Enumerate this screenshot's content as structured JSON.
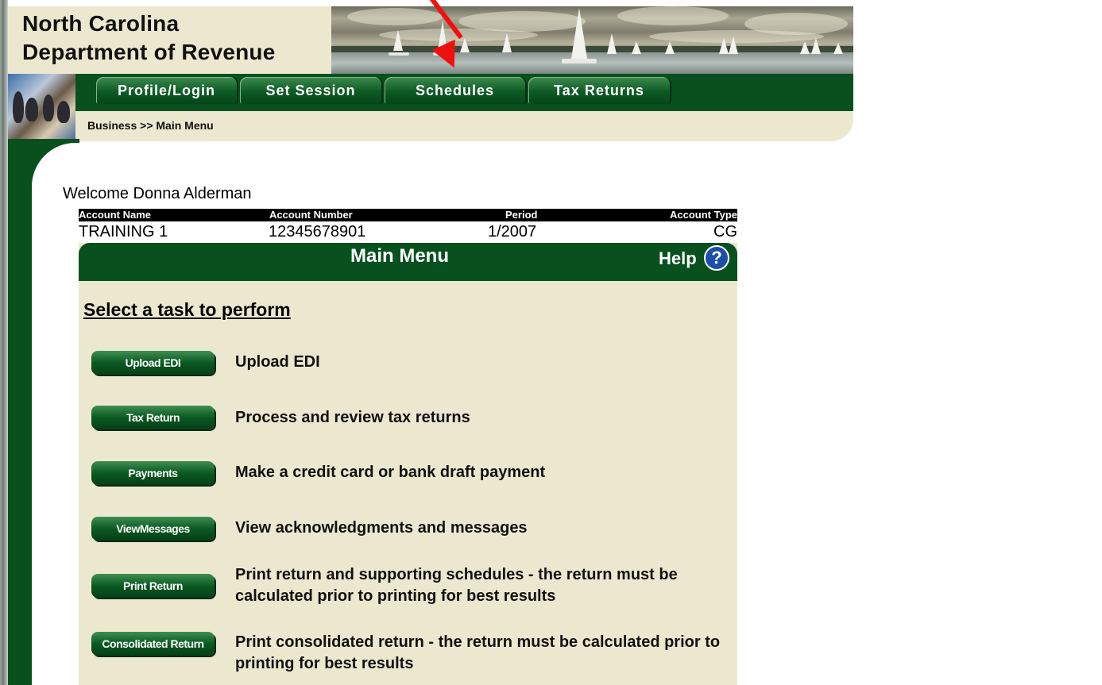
{
  "header": {
    "title_line1": "North Carolina",
    "title_line2": "Department of Revenue"
  },
  "nav": {
    "tabs": [
      {
        "label": "Profile/Login"
      },
      {
        "label": "Set Session"
      },
      {
        "label": "Schedules"
      },
      {
        "label": "Tax Returns"
      }
    ]
  },
  "breadcrumb": "Business >> Main Menu",
  "welcome": "Welcome Donna Alderman",
  "account": {
    "headers": [
      "Account Name",
      "Account Number",
      "Period",
      "Account Type"
    ],
    "values": [
      "TRAINING 1",
      "12345678901",
      "1/2007",
      "CG"
    ]
  },
  "panel": {
    "title": "Main Menu",
    "help_label": "Help",
    "help_glyph": "?"
  },
  "tasks": {
    "heading": "Select a task to perform",
    "items": [
      {
        "button": "Upload EDI",
        "description": "Upload EDI"
      },
      {
        "button": "Tax Return",
        "description": "Process and review tax returns"
      },
      {
        "button": "Payments",
        "description": "Make a credit card or bank draft payment"
      },
      {
        "button": "ViewMessages",
        "description": "View acknowledgments and messages"
      },
      {
        "button": "Print Return",
        "description": "Print return and supporting schedules - the return must be calculated prior to printing for best results"
      },
      {
        "button": "Consolidated Return",
        "description": "Print consolidated return - the return must be calculated prior to printing for best results"
      }
    ]
  },
  "colors": {
    "nav_green": "#08501e",
    "panel_beige": "#ece8cf",
    "annotation_red": "#f01010"
  }
}
